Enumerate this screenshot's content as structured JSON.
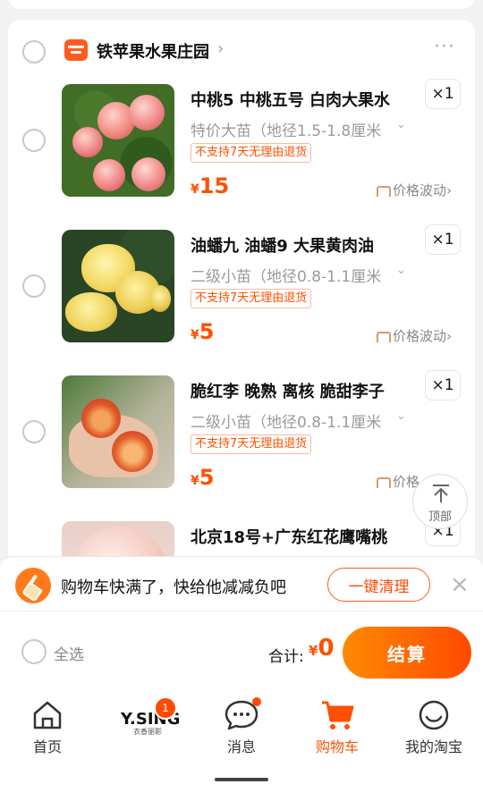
{
  "shop": {
    "name": "铁苹果水果庄园",
    "more": "···"
  },
  "items": [
    {
      "title": "中桃5 中桃五号 白肉大果水",
      "spec": "特价大苗（地径1.5-1.8厘米",
      "tag": "不支持7天无理由退货",
      "currency": "¥",
      "price": "15",
      "qty": "×1",
      "wave": "价格波动"
    },
    {
      "title": "油蟠九  油蟠9  大果黄肉油",
      "spec": "二级小苗（地径0.8-1.1厘米",
      "tag": "不支持7天无理由退货",
      "currency": "¥",
      "price": "5",
      "qty": "×1",
      "wave": "价格波动"
    },
    {
      "title": "脆红李 晚熟 离核 脆甜李子",
      "spec": "二级小苗（地径0.8-1.1厘米",
      "tag": "不支持7天无理由退货",
      "currency": "¥",
      "price": "5",
      "qty": "×1",
      "wave": "价格"
    },
    {
      "title": "北京18号+广东红花鹰嘴桃",
      "qty": "×1"
    }
  ],
  "top_button": {
    "label": "顶部"
  },
  "notice": {
    "text": "购物车快满了，快给他减减负吧",
    "button": "一键清理",
    "close": "×"
  },
  "footer": {
    "select_all": "全选",
    "total_label": "合计:",
    "total_currency": "¥",
    "total_value": "0",
    "checkout": "结算"
  },
  "tabs": [
    {
      "label": "首页"
    },
    {
      "logo_main": "Y.SING",
      "logo_sub": "衣香丽影",
      "badge": "1"
    },
    {
      "label": "消息"
    },
    {
      "label": "购物车"
    },
    {
      "label": "我的淘宝"
    }
  ],
  "colors": {
    "accent": "#ff5000",
    "checkout_start": "#ff8a00",
    "checkout_end": "#ff4a00"
  }
}
